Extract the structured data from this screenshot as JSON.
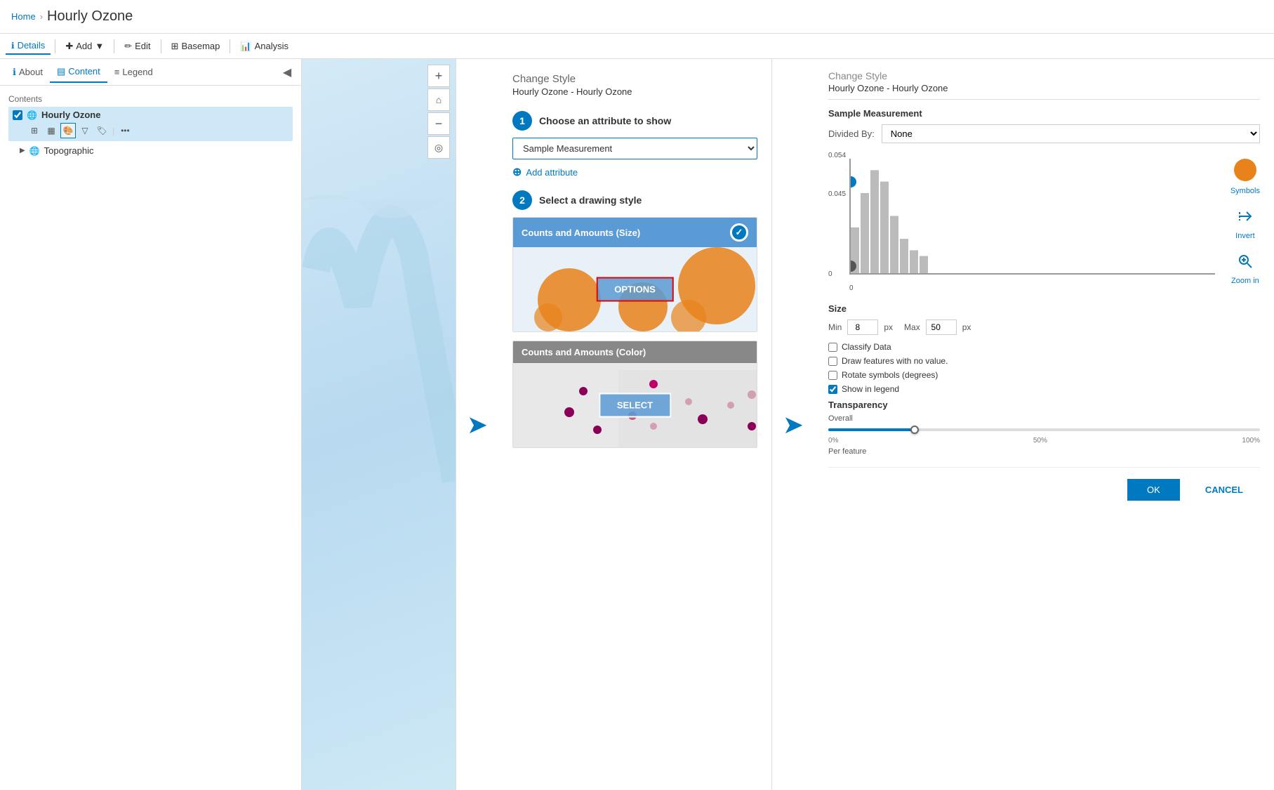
{
  "header": {
    "home_label": "Home",
    "sep": "›",
    "title": "Hourly Ozone"
  },
  "toolbar": {
    "details_label": "Details",
    "add_label": "Add",
    "edit_label": "Edit",
    "basemap_label": "Basemap",
    "analysis_label": "Analysis"
  },
  "sidebar_tabs": {
    "about_label": "About",
    "content_label": "Content",
    "legend_label": "Legend"
  },
  "contents": {
    "label": "Contents",
    "layer_name": "Hourly Ozone",
    "sub_layer": "Topographic"
  },
  "change_style_panel": {
    "title": "Change Style",
    "subtitle": "Hourly Ozone - Hourly Ozone",
    "step1_label": "Choose an attribute to show",
    "step1_num": "1",
    "step2_label": "Select a drawing style",
    "step2_num": "2",
    "attribute_value": "Sample Measurement",
    "add_attribute_label": "Add attribute",
    "style1_label": "Counts and Amounts (Size)",
    "style2_label": "Counts and Amounts (Color)",
    "options_btn": "OPTIONS",
    "select_btn": "SELECT"
  },
  "right_panel": {
    "title": "Change Style",
    "subtitle": "Hourly Ozone - Hourly Ozone",
    "sample_measurement_title": "Sample Measurement",
    "divided_by_label": "Divided By:",
    "divided_by_value": "None",
    "histogram_top": "0.054",
    "histogram_mid": "0.045",
    "histogram_bottom": "0",
    "histogram_x": "0",
    "symbols_label": "Symbols",
    "invert_label": "Invert",
    "zoom_label": "Zoom in",
    "size_title": "Size",
    "size_min_label": "Min",
    "size_min_value": "8",
    "size_min_unit": "px",
    "size_max_label": "Max",
    "size_max_value": "50",
    "size_max_unit": "px",
    "classify_label": "Classify Data",
    "no_value_label": "Draw features with no value.",
    "rotate_label": "Rotate symbols (degrees)",
    "show_legend_label": "Show in legend",
    "transparency_title": "Transparency",
    "overall_label": "Overall",
    "per_feature_label": "Per feature",
    "pct_0": "0%",
    "pct_50": "50%",
    "pct_100": "100%",
    "ok_btn": "OK",
    "cancel_btn": "CANCEL"
  }
}
